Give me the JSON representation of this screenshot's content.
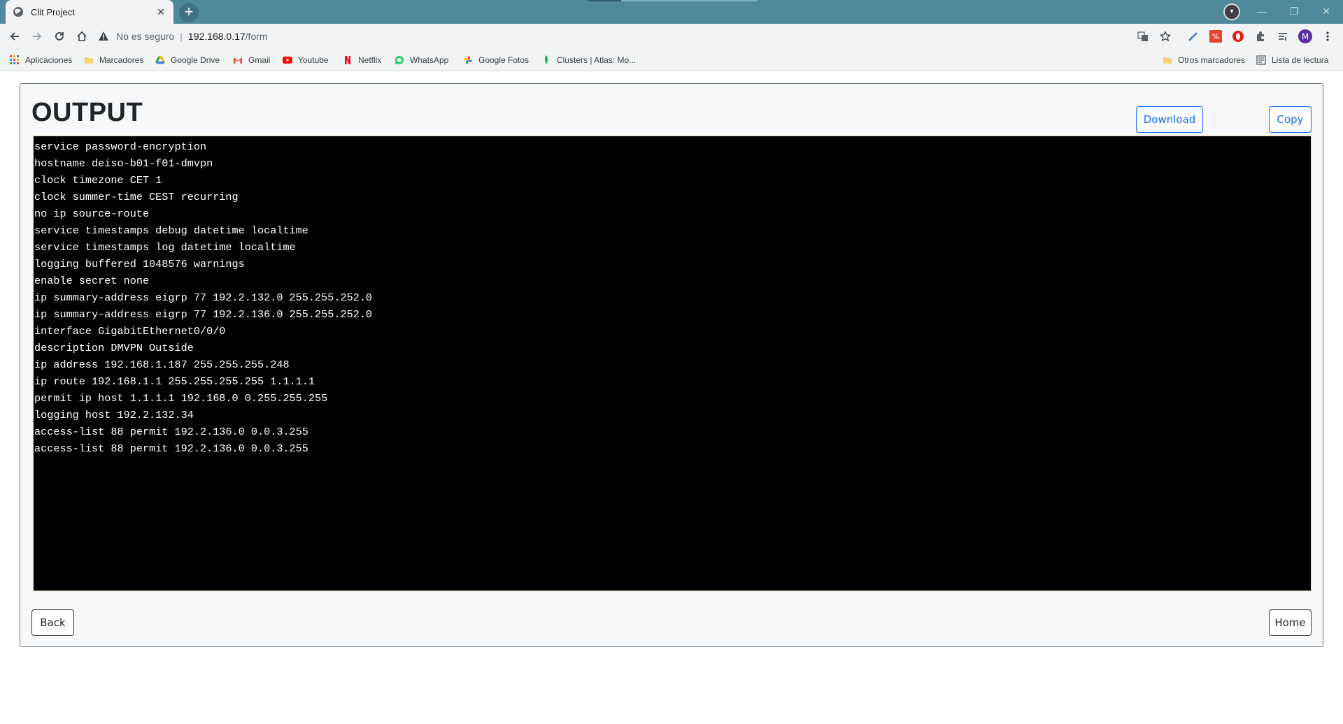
{
  "browser": {
    "tab_title": "Clit Project",
    "tab_close": "✕",
    "new_tab": "+",
    "profile_initial": "M",
    "window_controls": {
      "minimize": "—",
      "restore": "❐",
      "close": "✕"
    },
    "url": {
      "security": "No es seguro",
      "separator": "|",
      "host": "192.168.0.17",
      "path": "/form"
    },
    "bookmarks": [
      {
        "label": "Aplicaciones",
        "icon": "apps-grid-icon"
      },
      {
        "label": "Marcadores",
        "icon": "folder-icon"
      },
      {
        "label": "Google Drive",
        "icon": "google-drive-icon"
      },
      {
        "label": "Gmail",
        "icon": "gmail-icon"
      },
      {
        "label": "Youtube",
        "icon": "youtube-icon"
      },
      {
        "label": "Netflix",
        "icon": "netflix-icon"
      },
      {
        "label": "WhatsApp",
        "icon": "whatsapp-icon"
      },
      {
        "label": "Google Fotos",
        "icon": "google-photos-icon"
      },
      {
        "label": "Clusters | Atlas: Mo...",
        "icon": "mongodb-leaf-icon"
      }
    ],
    "other_bookmarks": "Otros marcadores",
    "reading_list": "Lista de lectura"
  },
  "page": {
    "title": "OUTPUT",
    "download_label": "Download",
    "copy_label": "Copy",
    "back_label": "Back",
    "home_label": "Home",
    "output_lines": [
      "service password-encryption",
      "hostname deiso-b01-f01-dmvpn",
      "clock timezone CET 1",
      "clock summer-time CEST recurring",
      "no ip source-route",
      "service timestamps debug datetime localtime",
      "service timestamps log datetime localtime",
      "logging buffered 1048576 warnings",
      "enable secret none",
      "ip summary-address eigrp 77 192.2.132.0 255.255.252.0",
      "ip summary-address eigrp 77 192.2.136.0 255.255.252.0",
      "interface GigabitEthernet0/0/0",
      "description DMVPN Outside",
      "ip address 192.168.1.187 255.255.255.248",
      "ip route 192.168.1.1 255.255.255.255 1.1.1.1",
      "permit ip host 1.1.1.1 192.168.0 0.255.255.255",
      "logging host 192.2.132.34",
      "access-list 88 permit 192.2.136.0 0.0.3.255",
      "access-list 88 permit 192.2.136.0 0.0.3.255"
    ]
  },
  "colors": {
    "tabbar": "#4e8a9c",
    "chrome": "#f1f3f4",
    "accent_blue": "#0d6efd",
    "terminal_bg": "#000000",
    "terminal_text": "#ffffff"
  }
}
